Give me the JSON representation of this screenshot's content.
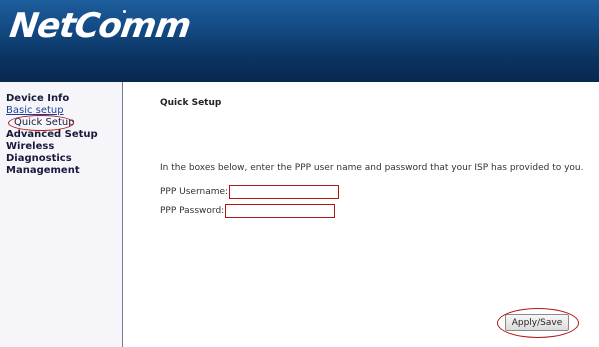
{
  "header": {
    "logo_text": "NetComm"
  },
  "sidebar": {
    "items": [
      {
        "label": "Device Info"
      },
      {
        "label": "Basic setup"
      },
      {
        "label": "Quick Setup"
      },
      {
        "label": "Advanced Setup"
      },
      {
        "label": "Wireless"
      },
      {
        "label": "Diagnostics"
      },
      {
        "label": "Management"
      }
    ]
  },
  "main": {
    "title": "Quick Setup",
    "instructions": "In the boxes below, enter the PPP user name and password that your ISP has provided to you.",
    "fields": {
      "username_label": "PPP Username:",
      "username_value": "",
      "password_label": "PPP Password:",
      "password_value": ""
    },
    "apply_label": "Apply/Save"
  },
  "colors": {
    "header_top": "#1d5e9d",
    "header_bottom": "#07284f",
    "highlight_red": "#b01818",
    "link_blue": "#1b3f9a"
  }
}
